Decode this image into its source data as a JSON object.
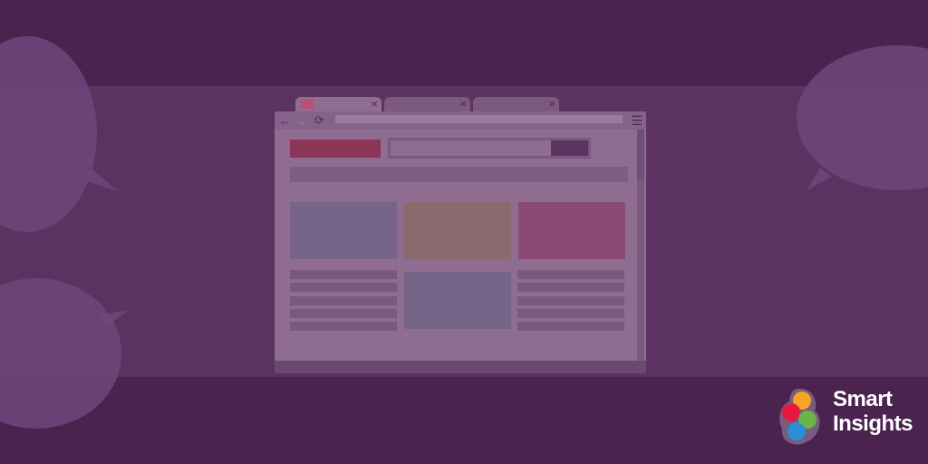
{
  "colors": {
    "background_dark": "#4a234f",
    "background_mid": "#5b3260",
    "bubble": "#71477b",
    "browser_body": "#8f6d90",
    "accent_red": "#8c3557",
    "card_blue": "#776489",
    "card_brown": "#8a6a6e",
    "card_pink": "#8a4a73"
  },
  "browser": {
    "tabs": [
      {
        "label": "",
        "active": true,
        "close_icon": "×"
      },
      {
        "label": "",
        "active": false,
        "close_icon": "×"
      },
      {
        "label": "",
        "active": false,
        "close_icon": "×"
      }
    ],
    "toolbar": {
      "back_icon": "←",
      "forward_icon": "→",
      "reload_icon": "⟳",
      "menu_icon": "☰",
      "address_value": ""
    }
  },
  "logo": {
    "line1": "Smart",
    "line2": "Insights",
    "circle_colors": [
      "#f5a623",
      "#e8193f",
      "#6ab547",
      "#2b8fd6"
    ]
  }
}
